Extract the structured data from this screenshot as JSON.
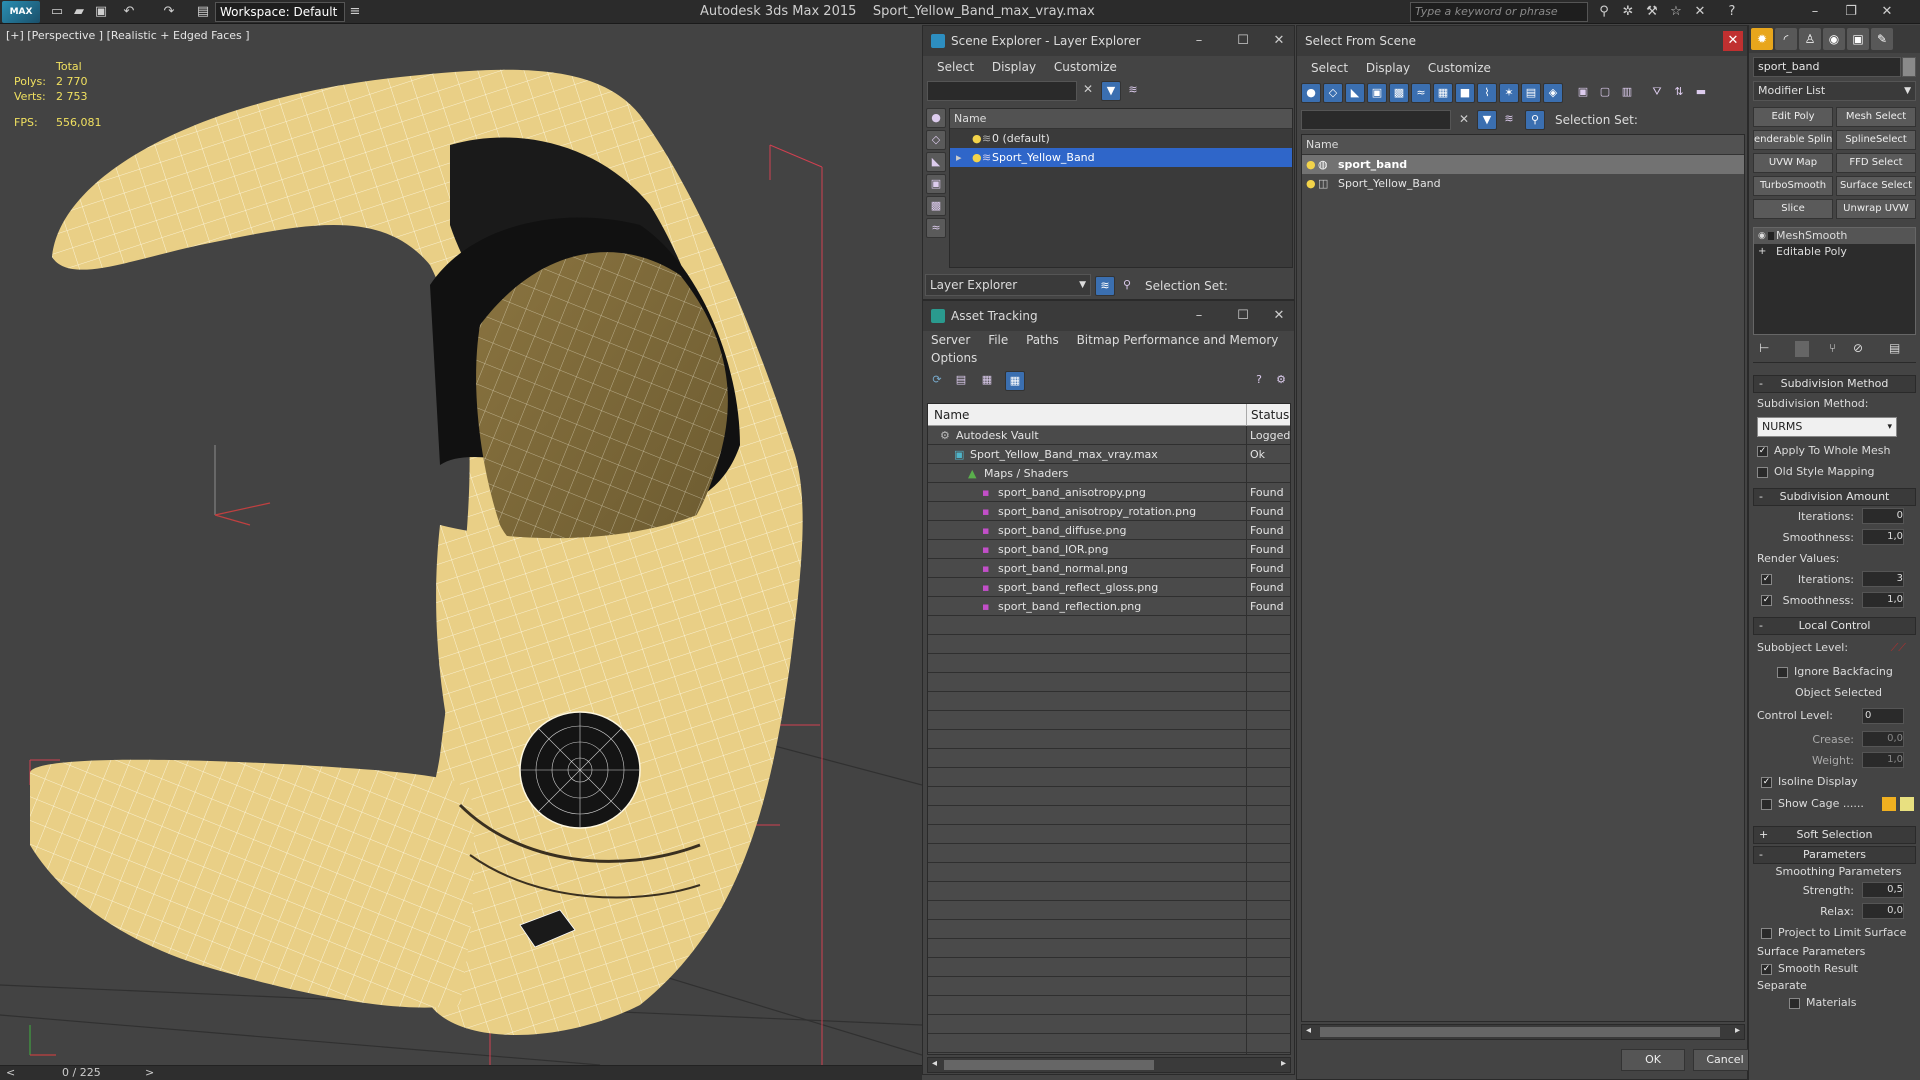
{
  "app": {
    "logo": "MAX",
    "title": "Autodesk 3ds Max  2015",
    "file": "Sport_Yellow_Band_max_vray.max",
    "workspace": "Workspace: Default",
    "search_placeholder": "Type a keyword or phrase"
  },
  "viewport": {
    "label": "[+] [Perspective ] [Realistic + Edged Faces ]",
    "stats": {
      "total_label": "Total",
      "polys_label": "Polys:",
      "polys": "2 770",
      "verts_label": "Verts:",
      "verts": "2 753",
      "fps_label": "FPS:",
      "fps": "556,081"
    },
    "mesh_colors": {
      "fill": "#e9cf86",
      "wire": "#ffffff",
      "shadow": "#8a7440"
    }
  },
  "timeline": {
    "counter": "0 / 225",
    "prev": "<",
    "next": ">"
  },
  "scene_explorer": {
    "title": "Scene Explorer - Layer Explorer",
    "menu": [
      "Select",
      "Display",
      "Customize"
    ],
    "col_name": "Name",
    "rows": [
      {
        "label": "0 (default)",
        "selected": false
      },
      {
        "label": "Sport_Yellow_Band",
        "selected": true
      }
    ],
    "footer_dropdown": "Layer Explorer",
    "selection_set": "Selection Set:"
  },
  "asset_tracking": {
    "title": "Asset Tracking",
    "menu": [
      "Server",
      "File",
      "Paths",
      "Bitmap Performance and Memory"
    ],
    "menu2": "Options",
    "col_name": "Name",
    "col_status": "Status",
    "rows": [
      {
        "name": "Autodesk Vault",
        "status": "Logged",
        "level": 0,
        "icon": "vault-icon"
      },
      {
        "name": "Sport_Yellow_Band_max_vray.max",
        "status": "Ok",
        "level": 1,
        "icon": "max-file-icon"
      },
      {
        "name": "Maps / Shaders",
        "status": "",
        "level": 2,
        "icon": "maps-icon"
      },
      {
        "name": "sport_band_anisotropy.png",
        "status": "Found",
        "level": 3,
        "icon": "png-icon"
      },
      {
        "name": "sport_band_anisotropy_rotation.png",
        "status": "Found",
        "level": 3,
        "icon": "png-icon"
      },
      {
        "name": "sport_band_diffuse.png",
        "status": "Found",
        "level": 3,
        "icon": "png-icon"
      },
      {
        "name": "sport_band_IOR.png",
        "status": "Found",
        "level": 3,
        "icon": "png-icon"
      },
      {
        "name": "sport_band_normal.png",
        "status": "Found",
        "level": 3,
        "icon": "png-icon"
      },
      {
        "name": "sport_band_reflect_gloss.png",
        "status": "Found",
        "level": 3,
        "icon": "png-icon"
      },
      {
        "name": "sport_band_reflection.png",
        "status": "Found",
        "level": 3,
        "icon": "png-icon"
      }
    ]
  },
  "select_from_scene": {
    "title": "Select From Scene",
    "menu": [
      "Select",
      "Display",
      "Customize"
    ],
    "selection_set": "Selection Set:",
    "col_name": "Name",
    "rows": [
      {
        "label": "sport_band",
        "selected": true
      },
      {
        "label": "Sport_Yellow_Band",
        "selected": false
      }
    ],
    "ok": "OK",
    "cancel": "Cancel"
  },
  "command_panel": {
    "object_name": "sport_band",
    "modifier_list": "Modifier List",
    "modifier_buttons": [
      "Edit Poly",
      "Mesh Select",
      "enderable Splin",
      "SplineSelect",
      "UVW Map",
      "FFD Select",
      "TurboSmooth",
      "Surface Select",
      "Slice",
      "Unwrap UVW"
    ],
    "stack": [
      {
        "label": "MeshSmooth",
        "selected": true
      },
      {
        "label": "Editable Poly",
        "selected": false
      }
    ],
    "subdivision_method": {
      "title": "Subdivision Method",
      "label": "Subdivision Method:",
      "value": "NURMS",
      "apply_whole": "Apply To Whole Mesh",
      "old_style": "Old Style Mapping"
    },
    "subdivision_amount": {
      "title": "Subdivision Amount",
      "iterations_label": "Iterations:",
      "iterations": "0",
      "smoothness_label": "Smoothness:",
      "smoothness": "1,0",
      "render_values": "Render Values:",
      "r_iterations_label": "Iterations:",
      "r_iterations": "3",
      "r_smoothness_label": "Smoothness:",
      "r_smoothness": "1,0"
    },
    "local_control": {
      "title": "Local Control",
      "subobject_level": "Subobject Level:",
      "ignore_backfacing": "Ignore Backfacing",
      "object_selected": "Object Selected",
      "control_level_label": "Control Level:",
      "control_level": "0",
      "crease_label": "Crease:",
      "crease": "0,0",
      "weight_label": "Weight:",
      "weight": "1,0",
      "isoline": "Isoline Display",
      "show_cage": "Show Cage ......",
      "cage_color1": "#f0b020",
      "cage_color2": "#e8e080"
    },
    "soft_selection": {
      "title": "Soft Selection"
    },
    "parameters": {
      "title": "Parameters",
      "smoothing_params": "Smoothing Parameters",
      "strength_label": "Strength:",
      "strength": "0,5",
      "relax_label": "Relax:",
      "relax": "0,0",
      "project": "Project to Limit Surface",
      "surface_params": "Surface Parameters",
      "smooth_result": "Smooth Result",
      "separate": "Separate",
      "materials": "Materials"
    }
  }
}
